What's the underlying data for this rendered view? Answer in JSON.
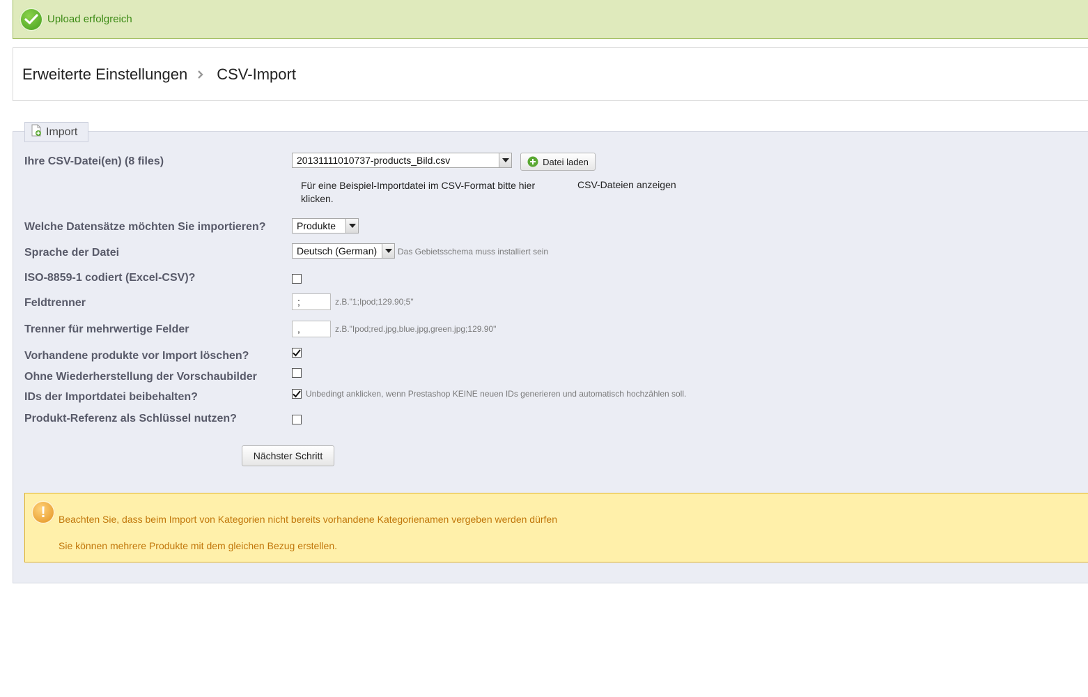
{
  "notification": {
    "success_text": "Upload erfolgreich"
  },
  "breadcrumb": {
    "parent": "Erweiterte Einstellungen",
    "current": "CSV-Import"
  },
  "import": {
    "legend": "Import",
    "file_label": "Ihre CSV-Datei(en) (8 files)",
    "file_select_value": "20131111010737-products_Bild.csv",
    "upload_button": "Datei laden",
    "sample_link_line1": "Für eine Beispiel-Importdatei im CSV-Format bitte hier",
    "sample_link_line2": "klicken.",
    "show_csv_link": "CSV-Dateien anzeigen",
    "entity_label": "Welche Datensätze möchten Sie importieren?",
    "entity_value": "Produkte",
    "language_label": "Sprache der Datei",
    "language_value": "Deutsch (German)",
    "language_hint": "Das Gebietsschema muss installiert sein",
    "iso_label": "ISO-8859-1 codiert (Excel-CSV)?",
    "separator_label": "Feldtrenner",
    "separator_value": ";",
    "separator_hint": "z.B.\"1;Ipod;129.90;5\"",
    "multi_separator_label": "Trenner für mehrwertige Felder",
    "multi_separator_value": ",",
    "multi_separator_hint": "z.B.\"Ipod;red.jpg,blue.jpg,green.jpg;129.90\"",
    "truncate_label": "Vorhandene produkte vor Import löschen?",
    "truncate_checked": true,
    "no_regen_label": "Ohne Wiederherstellung der Vorschaubilder",
    "no_regen_checked": false,
    "force_ids_label": "IDs der Importdatei beibehalten?",
    "force_ids_checked": true,
    "force_ids_hint": "Unbedingt anklicken, wenn Prestashop KEINE neuen IDs generieren und automatisch hochzählen soll.",
    "match_ref_label": "Produkt-Referenz als Schlüssel nutzen?",
    "match_ref_checked": false,
    "iso_checked": false,
    "next_button": "Nächster Schritt"
  },
  "warning": {
    "line1": "Beachten Sie, dass beim Import von Kategorien nicht bereits vorhandene Kategorienamen vergeben werden dürfen",
    "line2": "Sie können mehrere Produkte mit dem gleichen Bezug erstellen."
  },
  "colors": {
    "success_bg": "#dfeabc",
    "success_text": "#3b8a14",
    "panel_bg": "#ebedf4",
    "label_text": "#585a69",
    "warning_bg": "#fff0aa",
    "warning_text": "#c1760a"
  },
  "icons": {
    "success": "check-circle-icon",
    "separator": "chevron-right-icon",
    "legend": "import-file-icon",
    "upload": "plus-circle-icon",
    "warning": "exclamation-circle-icon"
  }
}
